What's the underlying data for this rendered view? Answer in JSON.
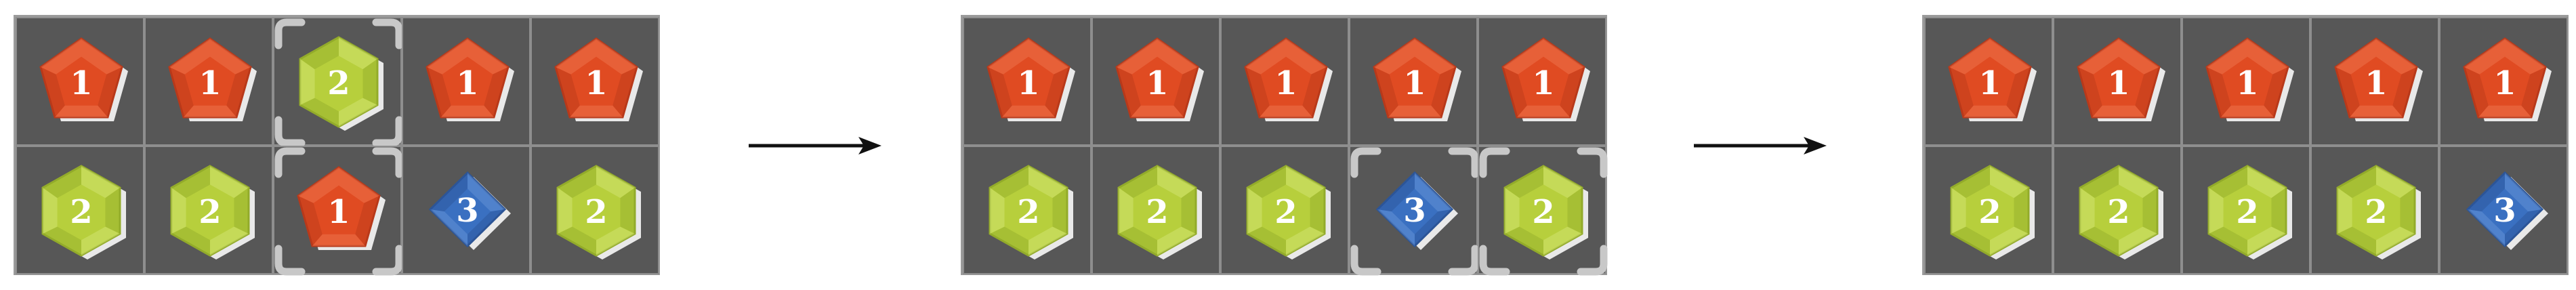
{
  "colors": {
    "board": "#575757",
    "red_gem": "#e04b22",
    "green_gem": "#b7cf3c",
    "blue_gem": "#3a70c1",
    "selection": "#c8c8c8"
  },
  "gem_types": {
    "1": {
      "shape": "pentagon",
      "color": "red"
    },
    "2": {
      "shape": "hexagon",
      "color": "green"
    },
    "3": {
      "shape": "diamond",
      "color": "blue"
    }
  },
  "steps": [
    {
      "grid": [
        [
          "1",
          "1",
          "2",
          "1",
          "1"
        ],
        [
          "2",
          "2",
          "1",
          "3",
          "2"
        ]
      ],
      "selected": [
        [
          0,
          2
        ],
        [
          1,
          2
        ]
      ]
    },
    {
      "grid": [
        [
          "1",
          "1",
          "1",
          "1",
          "1"
        ],
        [
          "2",
          "2",
          "2",
          "3",
          "2"
        ]
      ],
      "selected": [
        [
          1,
          3
        ],
        [
          1,
          4
        ]
      ]
    },
    {
      "grid": [
        [
          "1",
          "1",
          "1",
          "1",
          "1"
        ],
        [
          "2",
          "2",
          "2",
          "2",
          "3"
        ]
      ],
      "selected": []
    }
  ],
  "arrows": [
    "right-arrow",
    "right-arrow"
  ]
}
